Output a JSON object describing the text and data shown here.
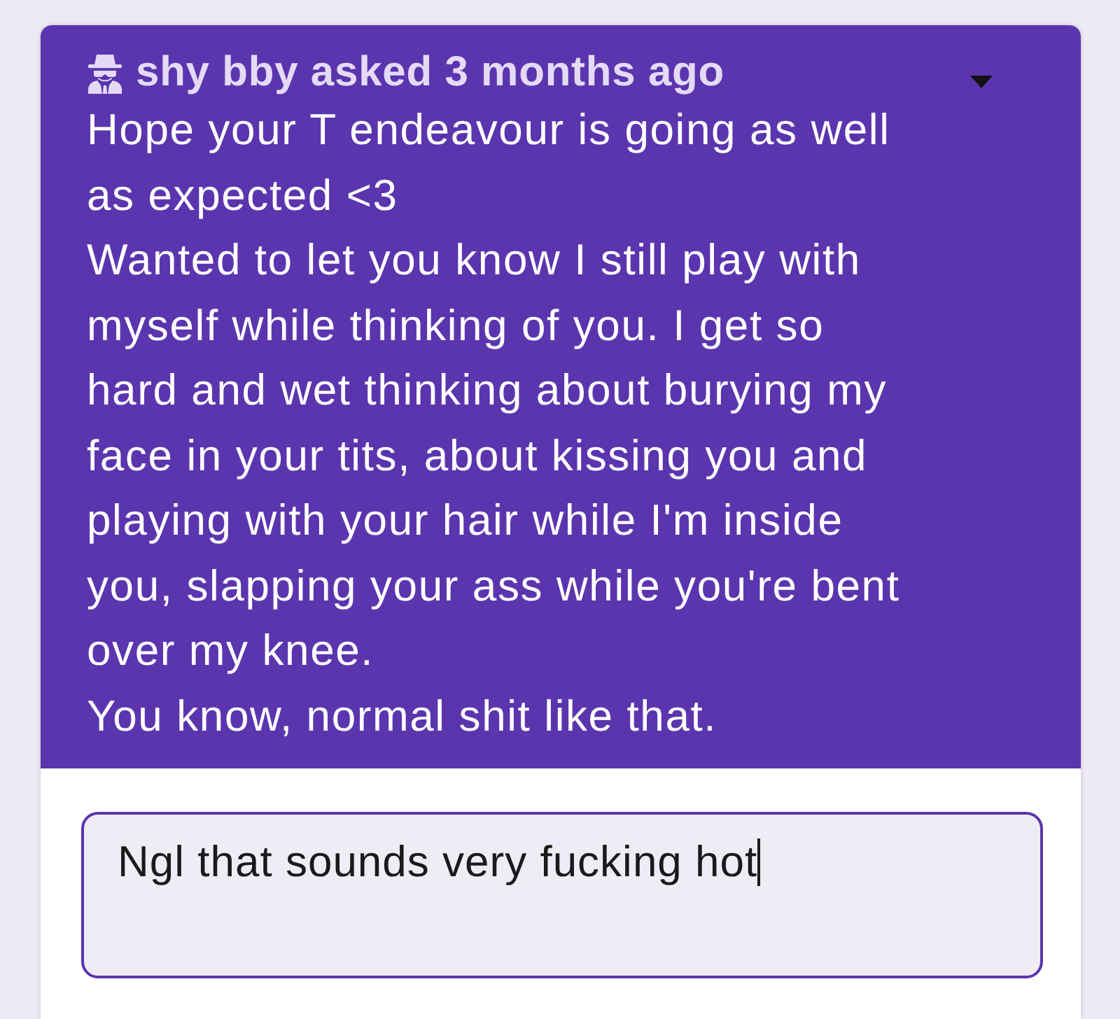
{
  "question": {
    "header": "shy bby asked 3 months ago",
    "menu_open": false,
    "paragraphs": [
      "Hope your T endeavour is going as well as expected <3",
      "Wanted to let you know I still play with myself while thinking of you. I get so hard and wet thinking about burying my face in your tits, about kissing you and playing with your hair while I'm inside you, slapping your ass while you're bent over my knee.",
      "You know, normal shit like that."
    ]
  },
  "reply": {
    "value": "Ngl that sounds very fucking hot",
    "focused": true
  }
}
